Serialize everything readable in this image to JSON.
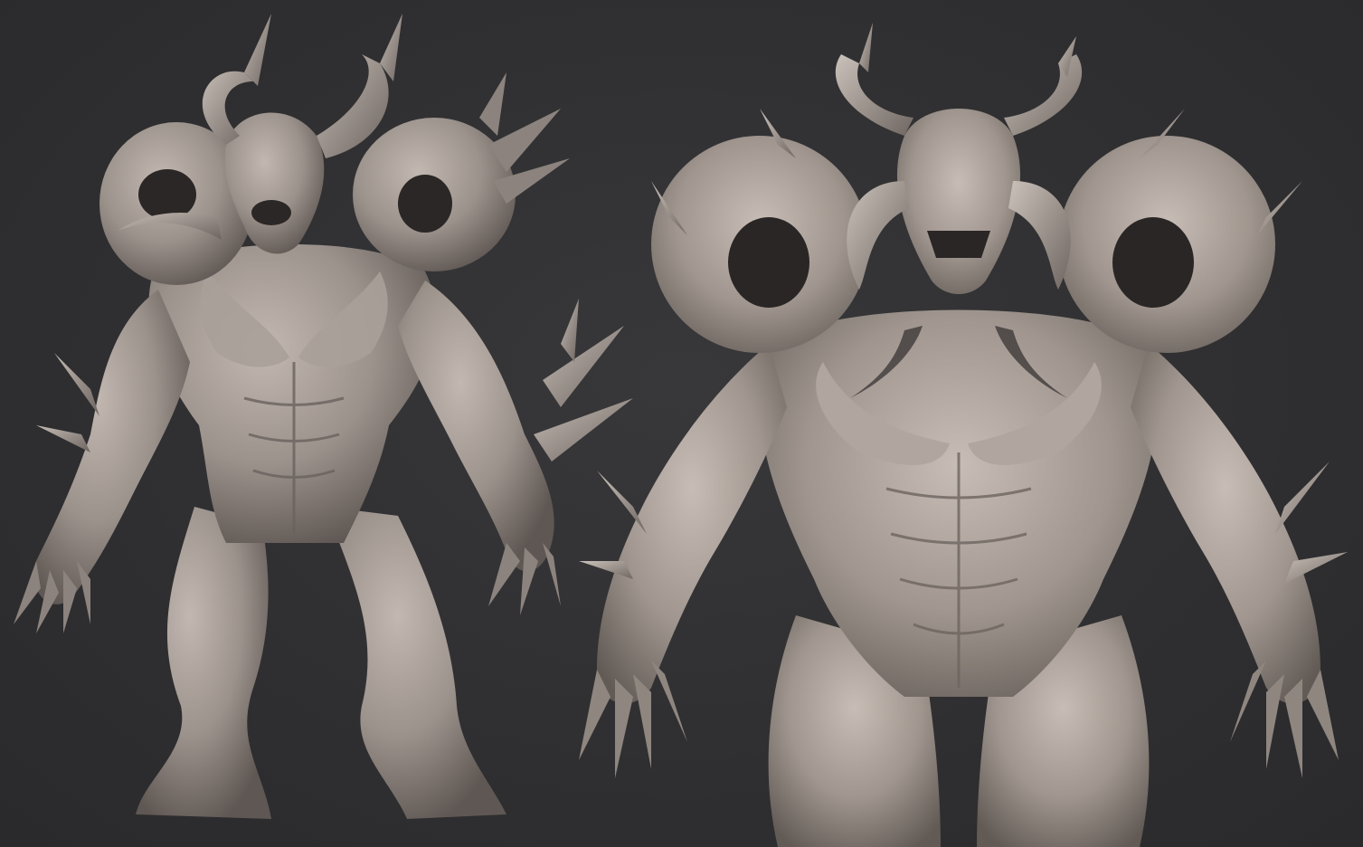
{
  "image": {
    "background_color": "#2f2f31",
    "clay_color": "#9c928c",
    "clay_shadow": "#5f5753",
    "clay_highlight": "#c7bdb6",
    "views": [
      {
        "name": "three-quarter-view"
      },
      {
        "name": "front-view"
      }
    ]
  }
}
